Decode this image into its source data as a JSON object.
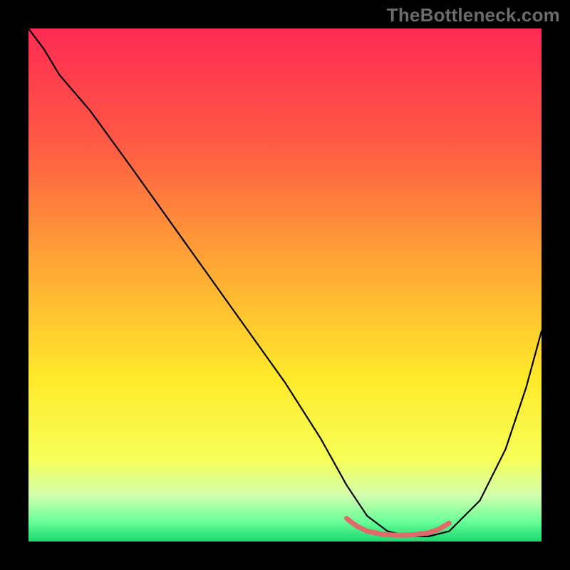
{
  "watermark": "TheBottleneck.com",
  "chart_data": {
    "type": "line",
    "title": "",
    "xlabel": "",
    "ylabel": "",
    "xlim": [
      0,
      100
    ],
    "ylim": [
      0,
      100
    ],
    "grid": false,
    "gradient_stops": [
      {
        "offset": 0,
        "color": "#ff2b54"
      },
      {
        "offset": 22,
        "color": "#ff5944"
      },
      {
        "offset": 45,
        "color": "#ffa436"
      },
      {
        "offset": 68,
        "color": "#ffe92a"
      },
      {
        "offset": 84,
        "color": "#f7ff58"
      },
      {
        "offset": 91,
        "color": "#d3ffae"
      },
      {
        "offset": 96,
        "color": "#6cff9a"
      },
      {
        "offset": 100,
        "color": "#19d96e"
      }
    ],
    "series": [
      {
        "name": "curve",
        "stroke": "#000000",
        "stroke_width": 2.2,
        "x": [
          0,
          3,
          6,
          12,
          20,
          30,
          40,
          50,
          57,
          62,
          66,
          70,
          74,
          78,
          82,
          88,
          93,
          97,
          100
        ],
        "y": [
          100,
          96,
          91,
          84,
          73,
          59,
          45,
          31,
          20,
          11,
          5,
          2,
          1,
          1,
          2,
          8,
          18,
          30,
          41
        ]
      },
      {
        "name": "optimal-band",
        "stroke": "#e06a6a",
        "stroke_width": 7,
        "x": [
          62,
          64,
          66,
          69,
          72,
          75,
          78,
          80,
          82
        ],
        "y": [
          4.5,
          3.0,
          2.0,
          1.4,
          1.2,
          1.3,
          1.7,
          2.4,
          3.6
        ]
      }
    ],
    "annotations": []
  }
}
